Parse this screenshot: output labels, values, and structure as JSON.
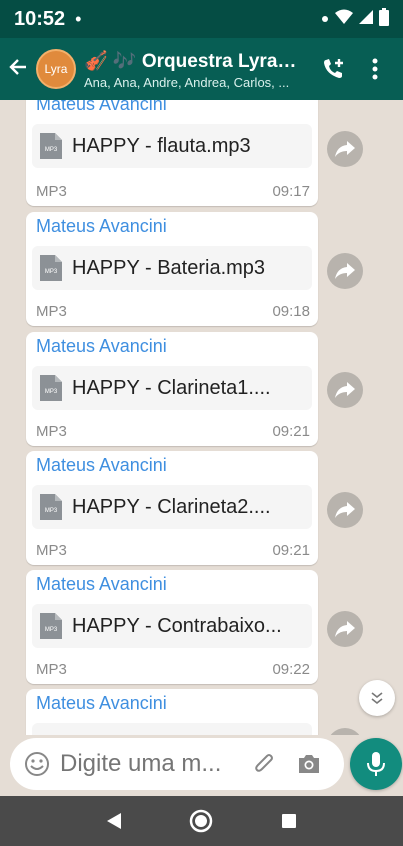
{
  "status_bar": {
    "time": "10:52",
    "dot": "•"
  },
  "header": {
    "avatar_label": "Lyra",
    "title": "🎻 🎶 Orquestra Lyra🎻 ...",
    "subtitle": "Ana, Ana, Andre, Andrea, Carlos, ..."
  },
  "messages": [
    {
      "sender": "Mateus Avancini",
      "file": "HAPPY - flauta.mp3",
      "type": "MP3",
      "time": "09:17"
    },
    {
      "sender": "Mateus Avancini",
      "file": "HAPPY - Bateria.mp3",
      "type": "MP3",
      "time": "09:18"
    },
    {
      "sender": "Mateus Avancini",
      "file": "HAPPY - Clarineta1....",
      "type": "MP3",
      "time": "09:21"
    },
    {
      "sender": "Mateus Avancini",
      "file": "HAPPY - Clarineta2....",
      "type": "MP3",
      "time": "09:21"
    },
    {
      "sender": "Mateus Avancini",
      "file": "HAPPY - Contrabaixo...",
      "type": "MP3",
      "time": "09:22"
    },
    {
      "sender": "Mateus Avancini"
    }
  ],
  "icons": {
    "mp3_label": "MP3"
  },
  "composer": {
    "placeholder": "Digite uma m..."
  },
  "colors": {
    "header": "#075e54",
    "status": "#054d44",
    "sender": "#3f8fe0",
    "mic": "#128c7e",
    "chat_bg": "#e5ddd5"
  }
}
